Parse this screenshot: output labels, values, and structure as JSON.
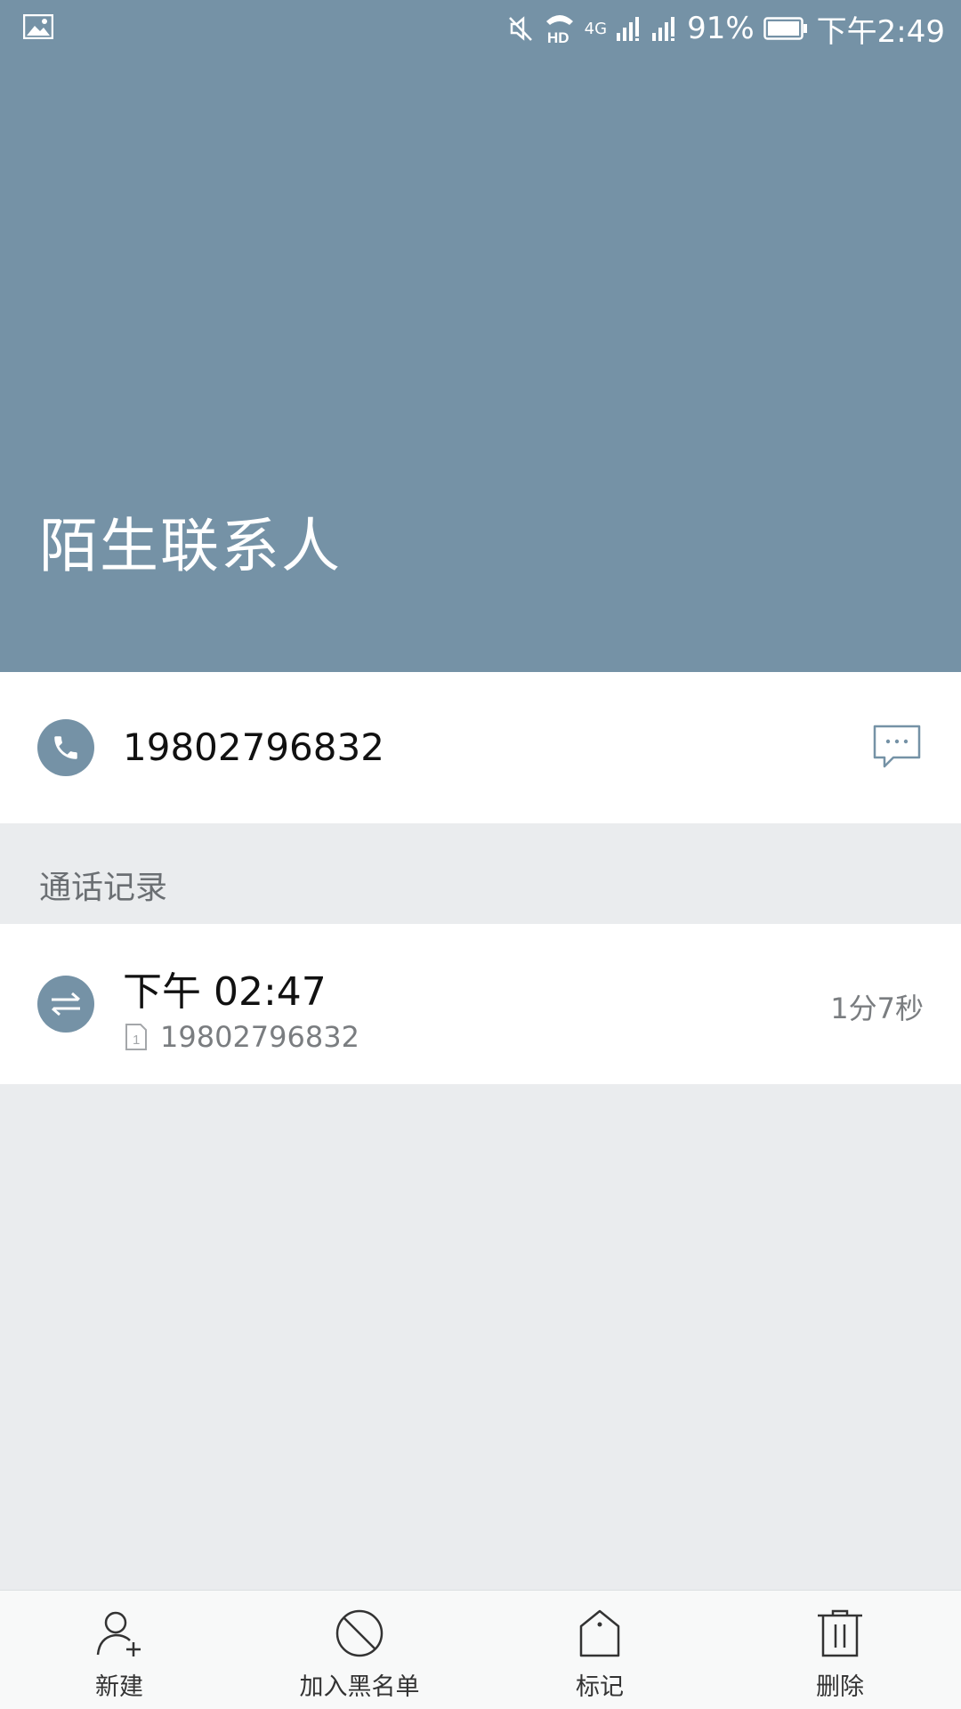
{
  "status_bar": {
    "battery_percent": "91%",
    "time": "下午2:49",
    "network_label": "4G",
    "hd_label": "HD",
    "icons": [
      "gallery-icon",
      "mute-icon",
      "hd-call-icon",
      "signal-icon",
      "signal-icon",
      "battery-icon"
    ]
  },
  "header": {
    "contact_name": "陌生联系人",
    "background_color": "#7592a6"
  },
  "number_card": {
    "phone_number": "19802796832",
    "call_icon": "phone-icon",
    "message_icon": "message-icon"
  },
  "call_records": {
    "section_title": "通话记录",
    "items": [
      {
        "time": "下午 02:47",
        "sim_label": "1",
        "number": "19802796832",
        "duration": "1分7秒",
        "type_icon": "transfer-call-icon"
      }
    ]
  },
  "bottom_bar": {
    "new_label": "新建",
    "block_label": "加入黑名单",
    "mark_label": "标记",
    "delete_label": "删除"
  }
}
